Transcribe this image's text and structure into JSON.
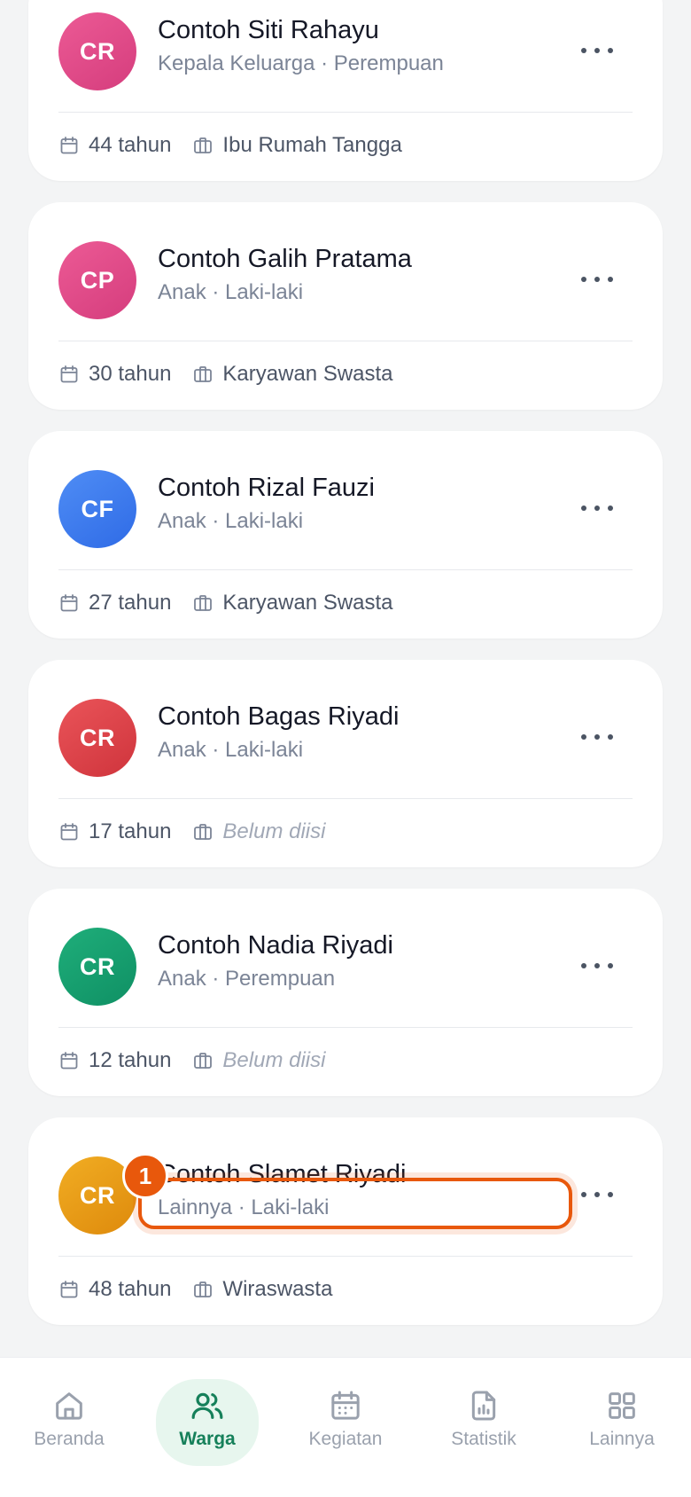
{
  "residents": [
    {
      "initials": "CR",
      "name": "Contoh Siti Rahayu",
      "subtitle": "Kepala Keluarga · Perempuan",
      "age": "44 tahun",
      "occupation": "Ibu Rumah Tangga",
      "occupation_empty": false,
      "avatar_from": "#ec5a95",
      "avatar_to": "#d53d7d"
    },
    {
      "initials": "CP",
      "name": "Contoh Galih Pratama",
      "subtitle": "Anak · Laki-laki",
      "age": "30 tahun",
      "occupation": "Karyawan Swasta",
      "occupation_empty": false,
      "avatar_from": "#ec5a95",
      "avatar_to": "#d53d7d"
    },
    {
      "initials": "CF",
      "name": "Contoh Rizal Fauzi",
      "subtitle": "Anak · Laki-laki",
      "age": "27 tahun",
      "occupation": "Karyawan Swasta",
      "occupation_empty": false,
      "avatar_from": "#4f8df5",
      "avatar_to": "#2f6be6"
    },
    {
      "initials": "CR",
      "name": "Contoh Bagas Riyadi",
      "subtitle": "Anak · Laki-laki",
      "age": "17 tahun",
      "occupation": "Belum diisi",
      "occupation_empty": true,
      "avatar_from": "#ea5459",
      "avatar_to": "#cf343c"
    },
    {
      "initials": "CR",
      "name": "Contoh Nadia Riyadi",
      "subtitle": "Anak · Perempuan",
      "age": "12 tahun",
      "occupation": "Belum diisi",
      "occupation_empty": true,
      "avatar_from": "#1fae7a",
      "avatar_to": "#0f9064"
    },
    {
      "initials": "CR",
      "name": "Contoh Slamet Riyadi",
      "subtitle": "Lainnya · Laki-laki",
      "age": "48 tahun",
      "occupation": "Wiraswasta",
      "occupation_empty": false,
      "avatar_from": "#f1ad23",
      "avatar_to": "#de8a0c"
    }
  ],
  "annotation": {
    "step": "1"
  },
  "nav": {
    "active": "warga",
    "items": [
      {
        "id": "beranda",
        "label": "Beranda",
        "icon": "home-icon"
      },
      {
        "id": "warga",
        "label": "Warga",
        "icon": "users-icon"
      },
      {
        "id": "kegiatan",
        "label": "Kegiatan",
        "icon": "calendar-icon"
      },
      {
        "id": "statistik",
        "label": "Statistik",
        "icon": "chart-file-icon"
      },
      {
        "id": "lainnya",
        "label": "Lainnya",
        "icon": "grid-icon"
      }
    ]
  },
  "colors": {
    "accent": "#16805a",
    "highlight": "#e8580c",
    "muted": "#9aa1ad"
  }
}
